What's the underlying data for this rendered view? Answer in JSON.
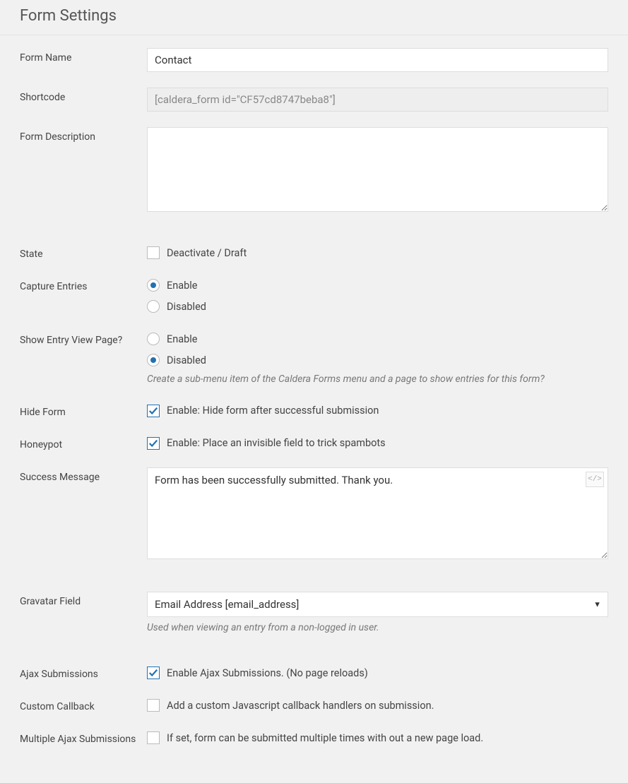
{
  "header": {
    "title": "Form Settings"
  },
  "fields": {
    "formName": {
      "label": "Form Name",
      "value": "Contact"
    },
    "shortcode": {
      "label": "Shortcode",
      "value": "[caldera_form id=\"CF57cd8747beba8\"]"
    },
    "formDescription": {
      "label": "Form Description",
      "value": ""
    },
    "state": {
      "label": "State",
      "optionLabel": "Deactivate / Draft"
    },
    "captureEntries": {
      "label": "Capture Entries",
      "options": {
        "enable": "Enable",
        "disabled": "Disabled"
      }
    },
    "showEntryView": {
      "label": "Show Entry View Page?",
      "options": {
        "enable": "Enable",
        "disabled": "Disabled"
      },
      "helper": "Create a sub-menu item of the Caldera Forms menu and a page to show entries for this form?"
    },
    "hideForm": {
      "label": "Hide Form",
      "optionLabel": "Enable: Hide form after successful submission"
    },
    "honeypot": {
      "label": "Honeypot",
      "optionLabel": "Enable: Place an invisible field to trick spambots"
    },
    "successMessage": {
      "label": "Success Message",
      "value": "Form has been successfully submitted. Thank you."
    },
    "gravatarField": {
      "label": "Gravatar Field",
      "selected": "Email Address [email_address]",
      "helper": "Used when viewing an entry from a non-logged in user."
    },
    "ajaxSubmissions": {
      "label": "Ajax Submissions",
      "optionLabel": "Enable Ajax Submissions. (No page reloads)"
    },
    "customCallback": {
      "label": "Custom Callback",
      "optionLabel": "Add a custom Javascript callback handlers on submission."
    },
    "multipleAjax": {
      "label": "Multiple Ajax Submissions",
      "optionLabel": "If set, form can be submitted multiple times with out a new page load."
    }
  }
}
